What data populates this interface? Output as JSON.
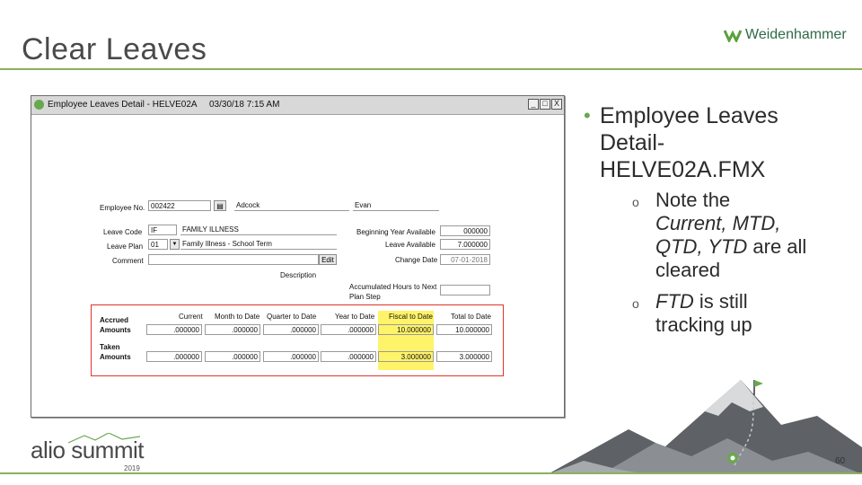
{
  "slide": {
    "title": "Clear Leaves",
    "brand": "Weidenhammer",
    "page_number": "60"
  },
  "footer": {
    "event": "alio summit",
    "year": "2019"
  },
  "window": {
    "title": "Employee Leaves Detail - HELVE02A",
    "datetime": "03/30/18  7:15 AM",
    "controls": [
      "_",
      "□",
      "X"
    ],
    "form": {
      "employee_no_label": "Employee No.",
      "employee_no": "002422",
      "last_name": "Adcock",
      "first_name": "Evan",
      "leave_code_label": "Leave Code",
      "leave_code": "IF",
      "leave_code_desc": "FAMILY ILLNESS",
      "leave_plan_label": "Leave Plan",
      "leave_plan": "01",
      "leave_plan_desc": "Family Illness - School Term",
      "comment_label": "Comment",
      "edit_button": "Edit",
      "beginning_year_label": "Beginning Year Available",
      "beginning_year_value": "000000",
      "leave_available_label": "Leave Available",
      "leave_available_value": "7.000000",
      "change_date_label": "Change Date",
      "change_date_value": "07-01-2018",
      "description_label": "Description",
      "accumulated_label": "Accumulated Hours to Next",
      "plan_step_label": "Plan Step",
      "columns": [
        "Current",
        "Month to Date",
        "Quarter to Date",
        "Year to Date",
        "Fiscal to Date",
        "Total to Date"
      ],
      "accrued_label_1": "Accrued",
      "accrued_label_2": "Amounts",
      "accrued": [
        ".000000",
        ".000000",
        ".000000",
        ".000000",
        "10.000000",
        "10.000000"
      ],
      "taken_label_1": "Taken",
      "taken_label_2": "Amounts",
      "taken": [
        ".000000",
        ".000000",
        ".000000",
        ".000000",
        "3.000000",
        "3.000000"
      ]
    }
  },
  "bullets": {
    "main": "Employee Leaves Detail-HELVE02A.FMX",
    "main_line1": "Employee Leaves",
    "main_line2": "Detail-",
    "main_line3": "HELVE02A.FMX",
    "sub1_a": "Note the",
    "sub1_b": "Current, MTD,",
    "sub1_c": "QTD, YTD",
    "sub1_d": " are all",
    "sub1_e": "cleared",
    "sub2_a": "FTD",
    "sub2_b": " is still",
    "sub2_c": "tracking up"
  },
  "colors": {
    "accent_green": "#8cb05a",
    "highlight_yellow": "#fff36a",
    "highlight_red": "#e0342a"
  }
}
